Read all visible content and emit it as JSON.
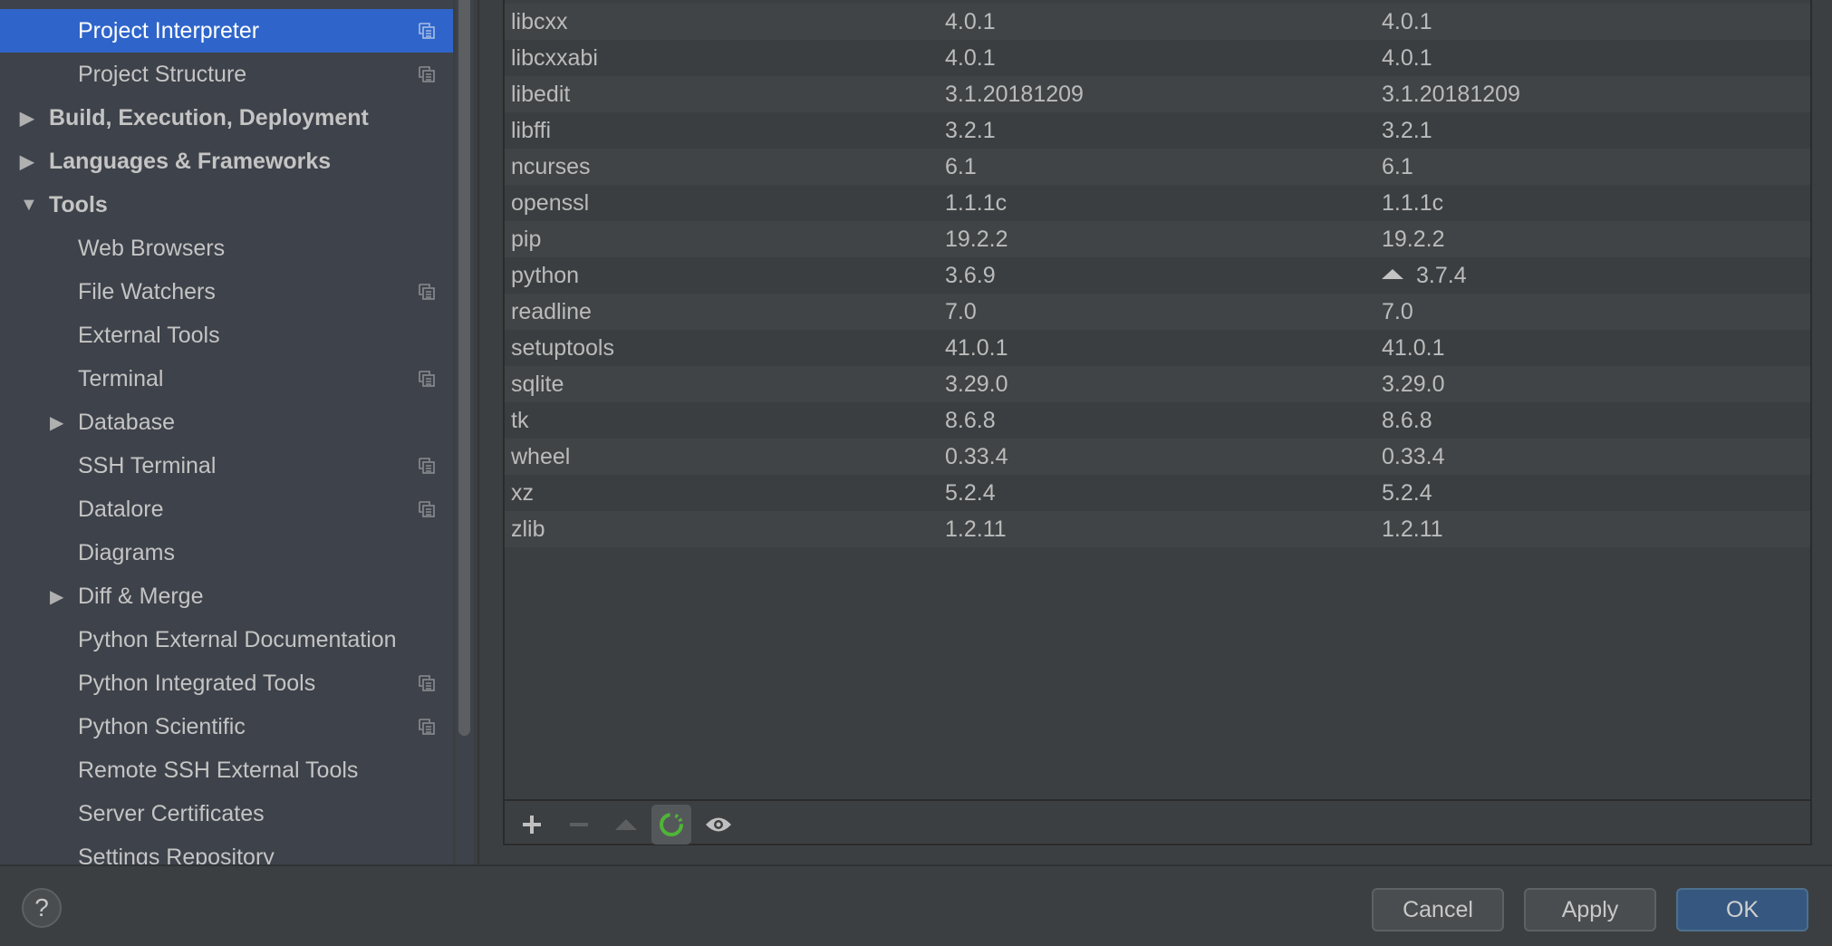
{
  "sidebar": {
    "items": [
      {
        "label": "Project Interpreter",
        "level": 1,
        "selected": true,
        "copy": true
      },
      {
        "label": "Project Structure",
        "level": 1,
        "copy": true
      },
      {
        "label": "Build, Execution, Deployment",
        "level": 0,
        "arrow": "collapsed"
      },
      {
        "label": "Languages & Frameworks",
        "level": 0,
        "arrow": "collapsed"
      },
      {
        "label": "Tools",
        "level": 0,
        "arrow": "expanded"
      },
      {
        "label": "Web Browsers",
        "level": 1
      },
      {
        "label": "File Watchers",
        "level": 1,
        "copy": true
      },
      {
        "label": "External Tools",
        "level": 1
      },
      {
        "label": "Terminal",
        "level": 1,
        "copy": true
      },
      {
        "label": "Database",
        "level": 1,
        "arrow": "collapsed"
      },
      {
        "label": "SSH Terminal",
        "level": 1,
        "copy": true
      },
      {
        "label": "Datalore",
        "level": 1,
        "copy": true
      },
      {
        "label": "Diagrams",
        "level": 1
      },
      {
        "label": "Diff & Merge",
        "level": 1,
        "arrow": "collapsed"
      },
      {
        "label": "Python External Documentation",
        "level": 1
      },
      {
        "label": "Python Integrated Tools",
        "level": 1,
        "copy": true
      },
      {
        "label": "Python Scientific",
        "level": 1,
        "copy": true
      },
      {
        "label": "Remote SSH External Tools",
        "level": 1
      },
      {
        "label": "Server Certificates",
        "level": 1
      },
      {
        "label": "Settings Repository",
        "level": 1
      }
    ]
  },
  "packages": [
    {
      "name": "libcxx",
      "version": "4.0.1",
      "latest": "4.0.1"
    },
    {
      "name": "libcxxabi",
      "version": "4.0.1",
      "latest": "4.0.1"
    },
    {
      "name": "libedit",
      "version": "3.1.20181209",
      "latest": "3.1.20181209"
    },
    {
      "name": "libffi",
      "version": "3.2.1",
      "latest": "3.2.1"
    },
    {
      "name": "ncurses",
      "version": "6.1",
      "latest": "6.1"
    },
    {
      "name": "openssl",
      "version": "1.1.1c",
      "latest": "1.1.1c"
    },
    {
      "name": "pip",
      "version": "19.2.2",
      "latest": "19.2.2"
    },
    {
      "name": "python",
      "version": "3.6.9",
      "latest": "3.7.4",
      "upgrade": true
    },
    {
      "name": "readline",
      "version": "7.0",
      "latest": "7.0"
    },
    {
      "name": "setuptools",
      "version": "41.0.1",
      "latest": "41.0.1"
    },
    {
      "name": "sqlite",
      "version": "3.29.0",
      "latest": "3.29.0"
    },
    {
      "name": "tk",
      "version": "8.6.8",
      "latest": "8.6.8"
    },
    {
      "name": "wheel",
      "version": "0.33.4",
      "latest": "0.33.4"
    },
    {
      "name": "xz",
      "version": "5.2.4",
      "latest": "5.2.4"
    },
    {
      "name": "zlib",
      "version": "1.2.11",
      "latest": "1.2.11"
    }
  ],
  "toolbar": {
    "icons": [
      "plus-icon",
      "minus-icon",
      "upgrade-icon",
      "loading-spinner-icon",
      "eye-icon"
    ]
  },
  "footer": {
    "help": "?",
    "cancel": "Cancel",
    "apply": "Apply",
    "ok": "OK"
  },
  "colors": {
    "selection": "#2f65ca",
    "ok_button": "#365880",
    "spinner": "#4fb537"
  }
}
